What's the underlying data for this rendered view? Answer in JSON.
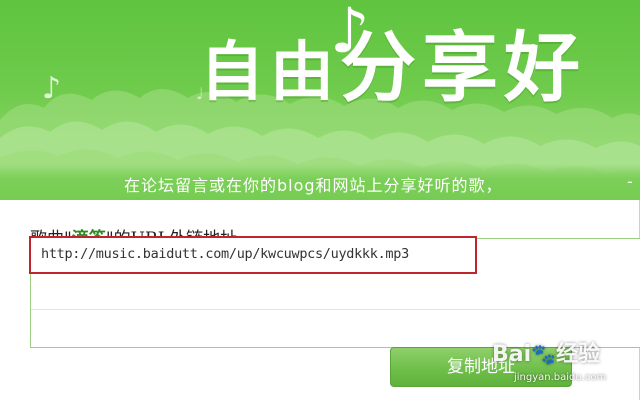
{
  "banner": {
    "hero_chars_small": "自由",
    "hero_chars_big": "分享好",
    "subtitle": "在论坛留言或在你的blog和网站上分享好听的歌，",
    "subtitle_tail": "-"
  },
  "icons": {
    "note_main": "♪",
    "note_small": "♪",
    "note_tiny": "♩"
  },
  "song": {
    "prefix": "歌曲\"",
    "name": "滴答",
    "suffix": "\"的URL外链地址"
  },
  "url": {
    "value": "http://music.baidutt.com/up/kwcuwpcs/uydkkk.mp3"
  },
  "buttons": {
    "copy_label": "复制地址"
  },
  "watermark": {
    "brand_a": "Bai",
    "paw": "🐾",
    "brand_b": "经验",
    "site": "jingyan.baidu.com"
  },
  "colors": {
    "banner_green": "#6fcb4c",
    "song_name_green": "#2e8b23",
    "highlight_red": "#c0242c",
    "button_green": "#6fbf4a"
  }
}
